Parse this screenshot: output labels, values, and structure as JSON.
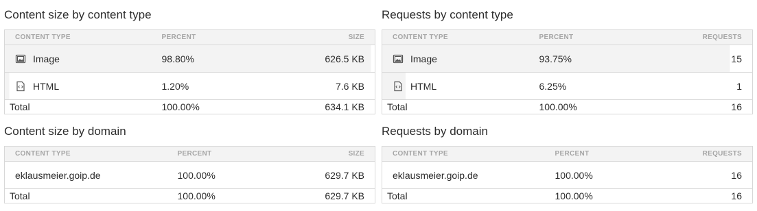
{
  "panels": {
    "size_by_type": {
      "title": "Content size by content type",
      "headers": {
        "type": "CONTENT TYPE",
        "percent": "PERCENT",
        "value": "SIZE"
      },
      "rows": [
        {
          "icon": "image-icon",
          "label": "Image",
          "percent": "98.80%",
          "value": "626.5 KB",
          "fill": 0.988
        },
        {
          "icon": "html-file-icon",
          "label": "HTML",
          "percent": "1.20%",
          "value": "7.6 KB",
          "fill": 0.012
        }
      ],
      "total": {
        "label": "Total",
        "percent": "100.00%",
        "value": "634.1 KB"
      }
    },
    "requests_by_type": {
      "title": "Requests by content type",
      "headers": {
        "type": "CONTENT TYPE",
        "percent": "PERCENT",
        "value": "REQUESTS"
      },
      "rows": [
        {
          "icon": "image-icon",
          "label": "Image",
          "percent": "93.75%",
          "value": "15",
          "fill": 0.9375
        },
        {
          "icon": "html-file-icon",
          "label": "HTML",
          "percent": "6.25%",
          "value": "1",
          "fill": 0.0625
        }
      ],
      "total": {
        "label": "Total",
        "percent": "100.00%",
        "value": "16"
      }
    },
    "size_by_domain": {
      "title": "Content size by domain",
      "headers": {
        "type": "CONTENT TYPE",
        "percent": "PERCENT",
        "value": "SIZE"
      },
      "rows": [
        {
          "label": "eklausmeier.goip.de",
          "percent": "100.00%",
          "value": "629.7 KB",
          "fill": 1.0
        }
      ],
      "total": {
        "label": "Total",
        "percent": "100.00%",
        "value": "629.7 KB"
      }
    },
    "requests_by_domain": {
      "title": "Requests by domain",
      "headers": {
        "type": "CONTENT TYPE",
        "percent": "PERCENT",
        "value": "REQUESTS"
      },
      "rows": [
        {
          "label": "eklausmeier.goip.de",
          "percent": "100.00%",
          "value": "16",
          "fill": 1.0
        }
      ],
      "total": {
        "label": "Total",
        "percent": "100.00%",
        "value": "16"
      }
    }
  },
  "colors": {
    "row_fill": "#f3f3f3",
    "border": "#d8d8d8",
    "header_text": "#a5a5a5"
  }
}
